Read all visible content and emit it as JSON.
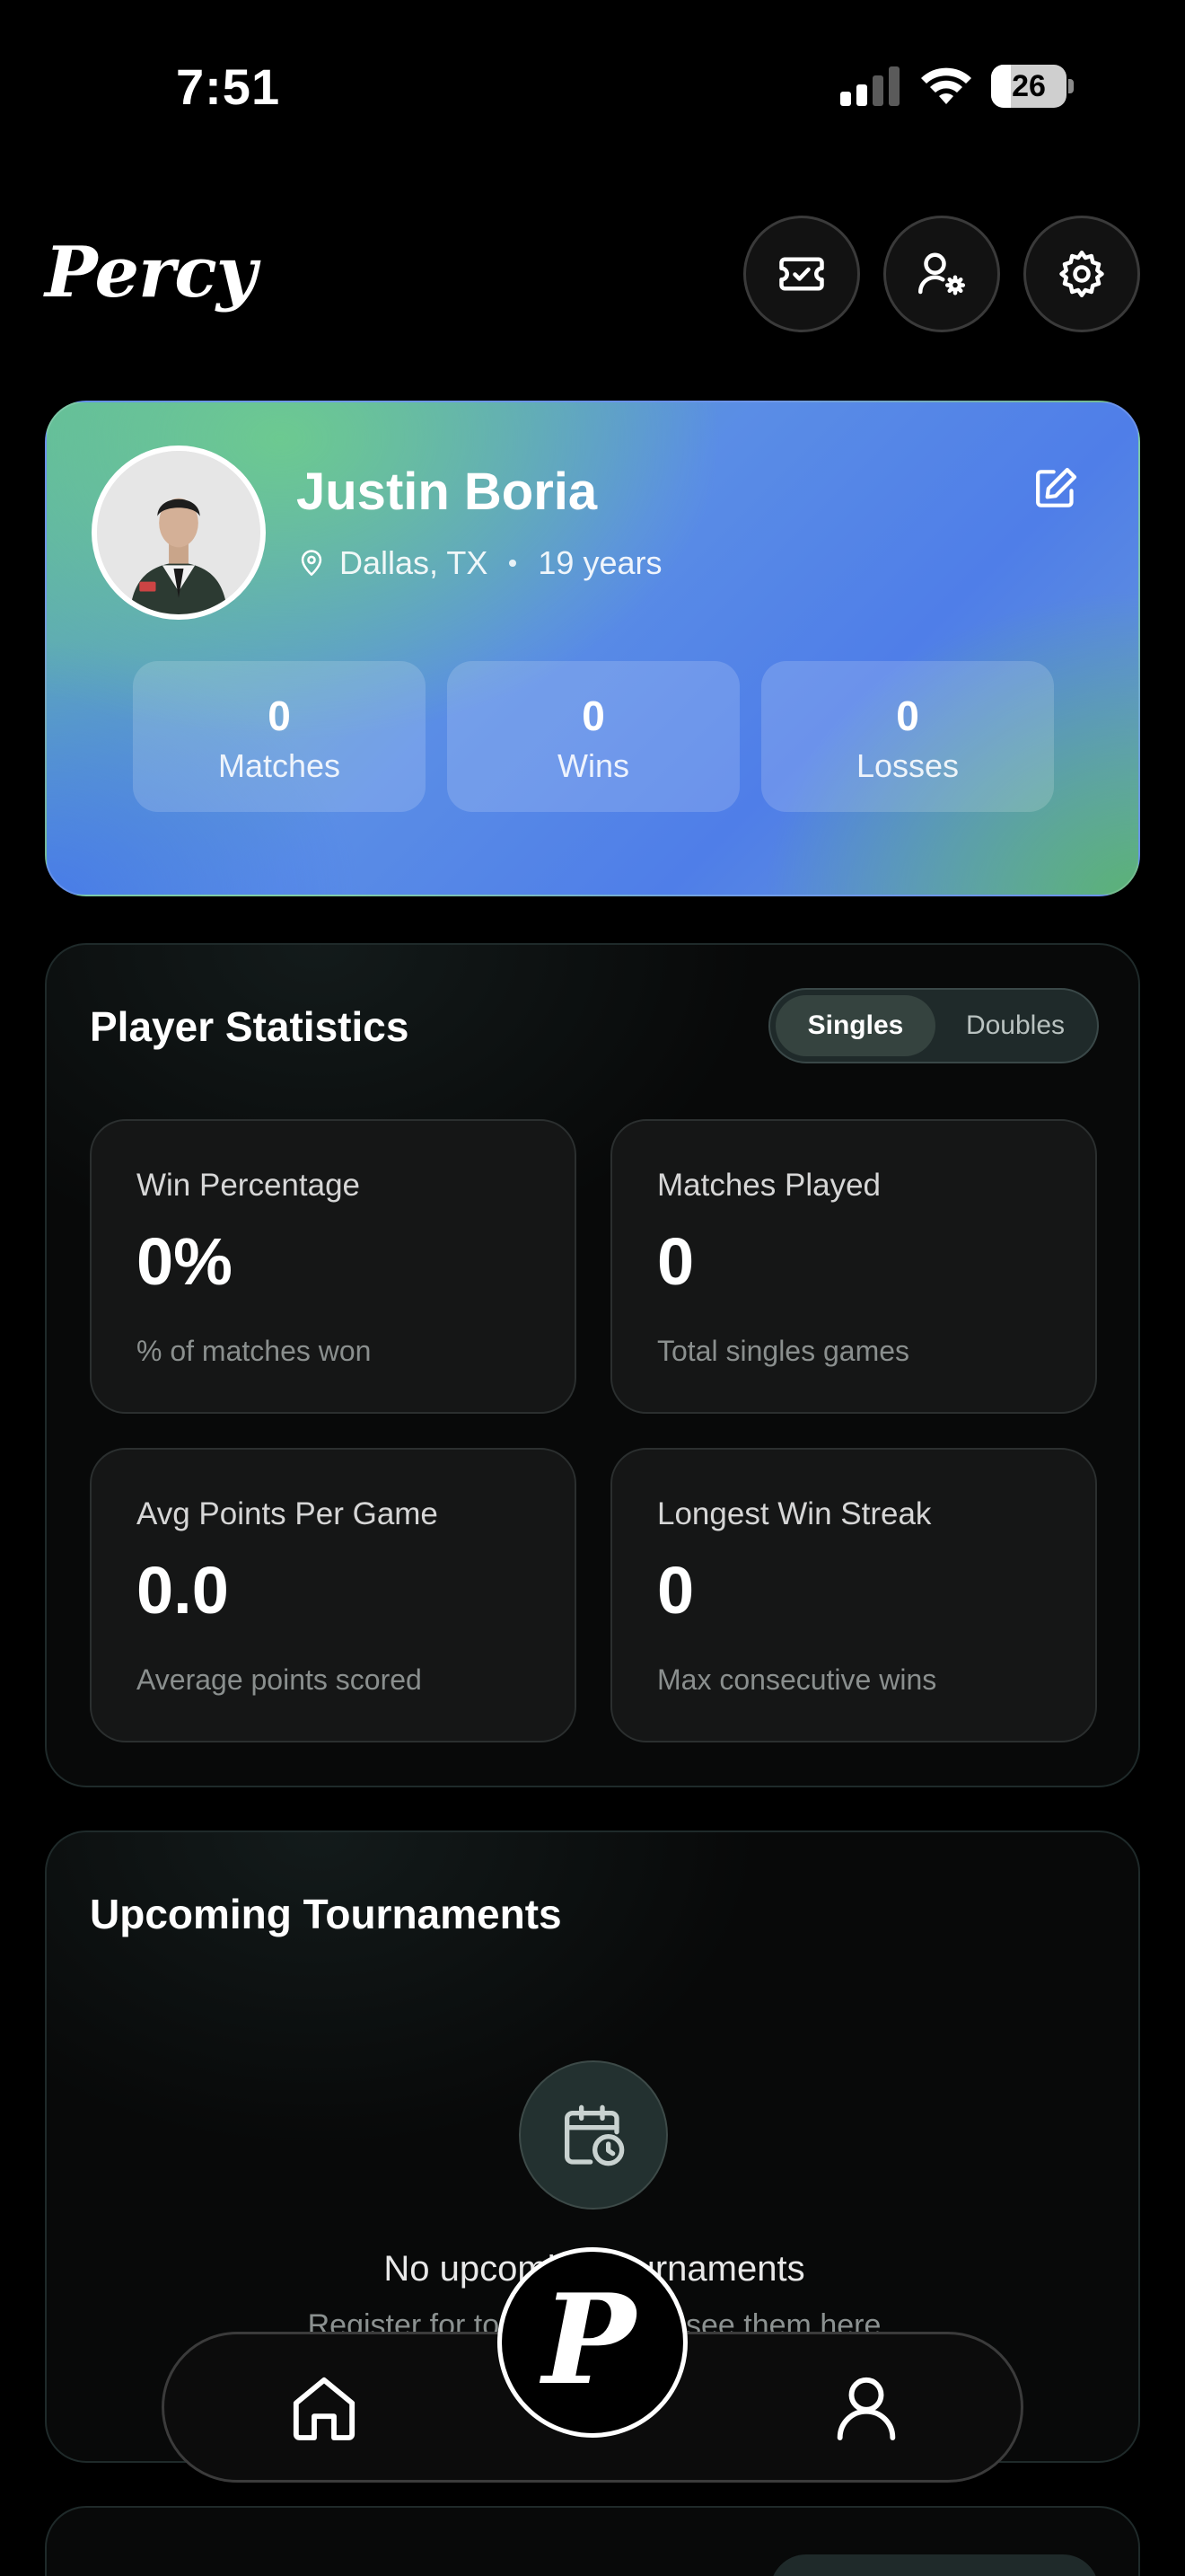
{
  "status_bar": {
    "time": "7:51",
    "battery": "26",
    "battery_level": 0.26
  },
  "header": {
    "logo": "Percy",
    "buttons": [
      {
        "name": "tickets-icon"
      },
      {
        "name": "user-settings-icon"
      },
      {
        "name": "gear-icon"
      }
    ]
  },
  "profile": {
    "name": "Justin Boria",
    "location": "Dallas, TX",
    "age": "19 years",
    "stats": [
      {
        "value": "0",
        "label": "Matches"
      },
      {
        "value": "0",
        "label": "Wins"
      },
      {
        "value": "0",
        "label": "Losses"
      }
    ]
  },
  "player_statistics": {
    "title": "Player Statistics",
    "toggle": {
      "active": "Singles",
      "inactive": "Doubles"
    },
    "cards": [
      {
        "title": "Win Percentage",
        "value": "0%",
        "subtitle": "% of matches won"
      },
      {
        "title": "Matches Played",
        "value": "0",
        "subtitle": "Total singles games"
      },
      {
        "title": "Avg Points Per Game",
        "value": "0.0",
        "subtitle": "Average points scored"
      },
      {
        "title": "Longest Win Streak",
        "value": "0",
        "subtitle": "Max consecutive wins"
      }
    ]
  },
  "tournaments": {
    "title": "Upcoming Tournaments",
    "empty_title": "No upcoming tournaments",
    "empty_subtitle": "Register for tournaments to see them here"
  },
  "bottom_nav": {
    "center_logo": "P",
    "items": [
      "home-icon",
      "profile-icon"
    ]
  },
  "colors": {
    "background": "#000000",
    "card_gradient_green": "#6ecd8c",
    "card_gradient_blue": "#4f7ee8"
  }
}
